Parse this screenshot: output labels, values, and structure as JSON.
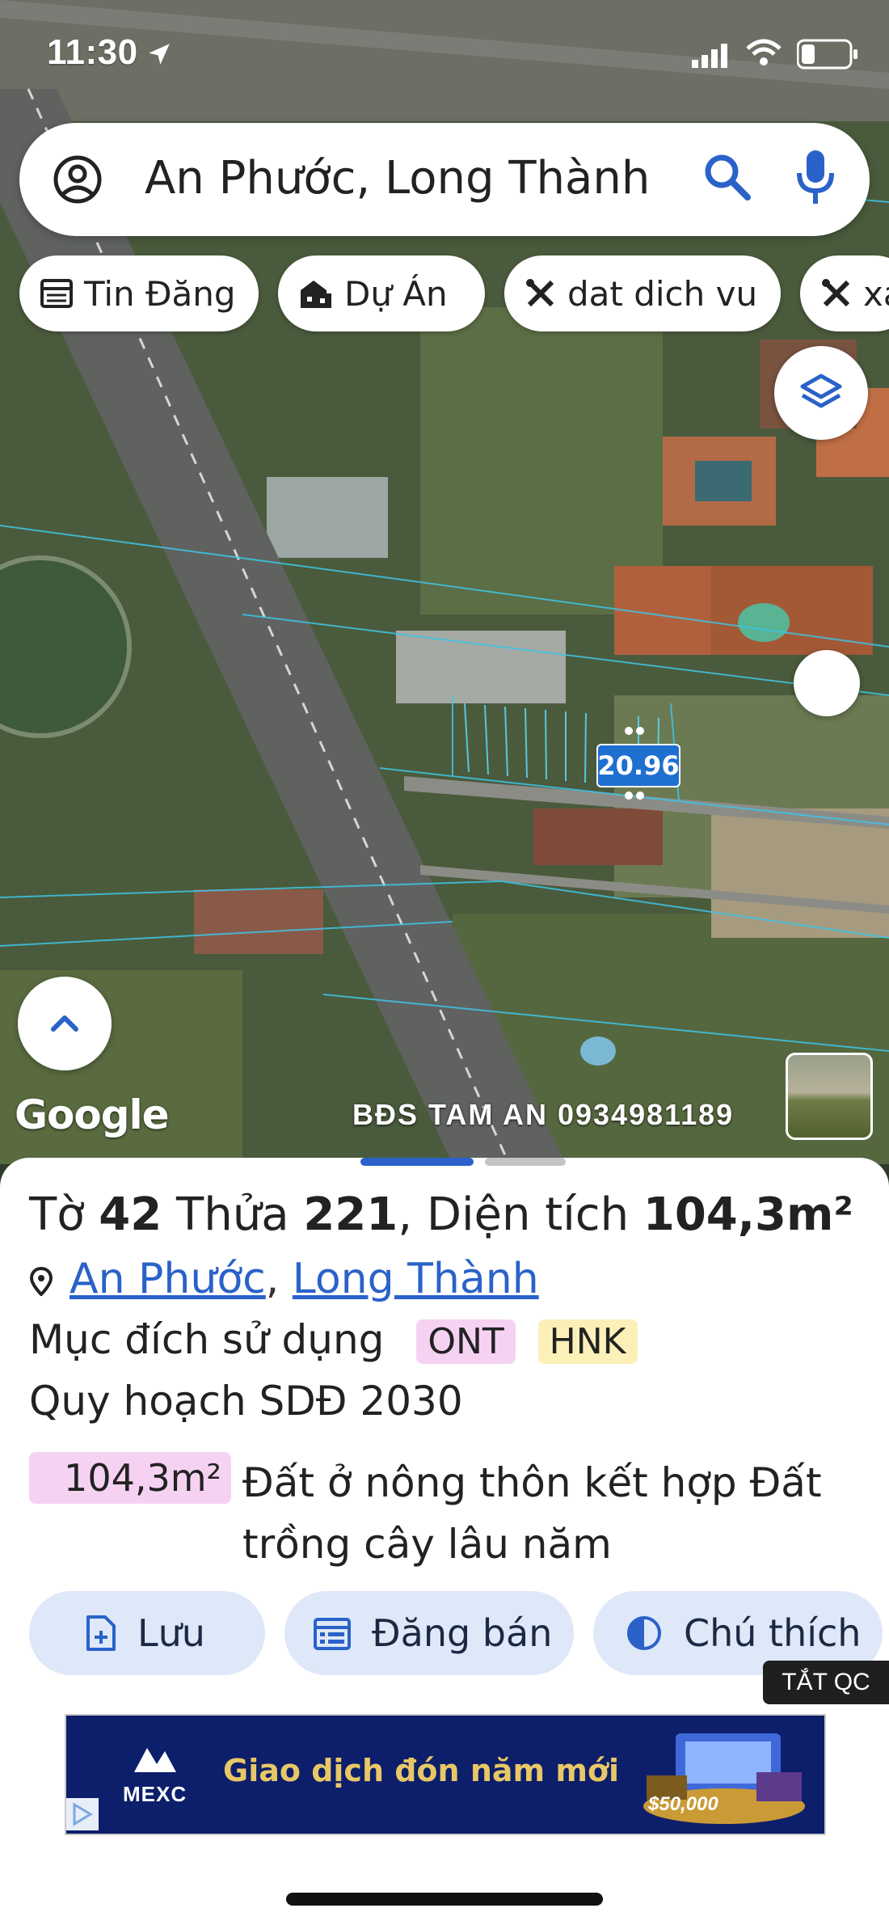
{
  "status_bar": {
    "time": "11:30",
    "icons": [
      "location-arrow-icon",
      "signal-icon",
      "wifi-icon",
      "battery-icon"
    ]
  },
  "search": {
    "account_icon": "account-circle-icon",
    "query": "An Phước, Long Thành",
    "search_icon": "search-icon",
    "mic_icon": "mic-icon"
  },
  "chips": [
    {
      "label": "Tin Đăng",
      "icon": "listing-icon"
    },
    {
      "label": "Dự Án",
      "icon": "building-icon"
    },
    {
      "label": "dat dich vu",
      "icon": "tools-icon"
    },
    {
      "label": "xa",
      "icon": "tools-icon"
    }
  ],
  "map": {
    "layers_icon": "layers-icon",
    "measurement": "20.96",
    "expand_icon": "chevron-up-icon",
    "google_logo": "Google",
    "watermark": "BĐS TAM AN 0934981189",
    "thumbnail": "street-view-thumbnail"
  },
  "sheet": {
    "title_prefix": "Tờ ",
    "sheet_no": "42",
    "parcel_label": " Thửa ",
    "parcel_no": "221",
    "area_label": ", Diện tích ",
    "area_value": "104,3m²",
    "location_icon": "location-pin-icon",
    "commune": "An Phước",
    "location_sep": ",",
    "district": "Long Thành",
    "purpose_label": "Mục đích sử dụng",
    "purpose_tags": [
      {
        "code": "ONT",
        "color": "#f6d2f2"
      },
      {
        "code": "HNK",
        "color": "#fbf0b8"
      }
    ],
    "plan_label": "Quy hoạch SDĐ 2030",
    "plan_area": "104,3m²",
    "plan_desc": "Đất ở nông thôn kết hợp Đất trồng cây lâu năm",
    "plan_area_color": "#f6d2f2"
  },
  "actions": [
    {
      "label": "Lưu",
      "icon": "add-document-icon"
    },
    {
      "label": "Đăng bán",
      "icon": "calendar-list-icon"
    },
    {
      "label": "Chú thích",
      "icon": "contrast-icon"
    }
  ],
  "ad": {
    "toggle": "TẮT QC",
    "brand": "MEXC",
    "text": "Giao dịch đón năm mới",
    "prize": "$50,000"
  },
  "colors": {
    "accent": "#2a62c9",
    "action_bg": "#dfe8f8",
    "handle_active": "#2a62c9",
    "handle_inactive": "#c4c4c4"
  }
}
